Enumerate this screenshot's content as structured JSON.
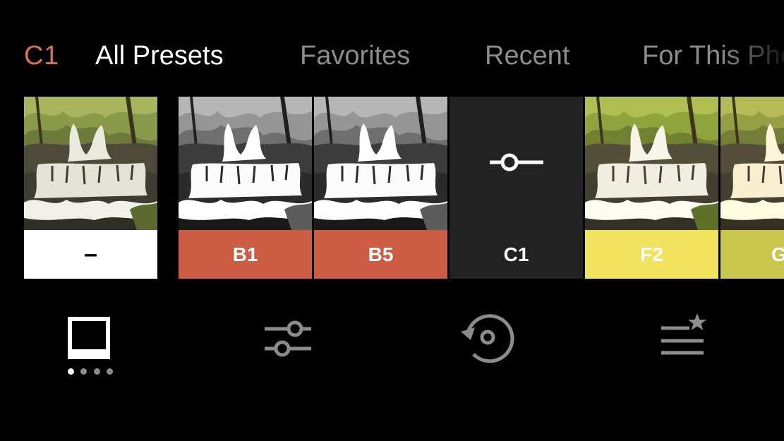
{
  "header": {
    "current_preset": "C1",
    "tabs": [
      {
        "label": "All Presets",
        "active": true
      },
      {
        "label": "Favorites",
        "active": false
      },
      {
        "label": "Recent",
        "active": false
      },
      {
        "label": "For This Photo",
        "active": false
      }
    ]
  },
  "presets": [
    {
      "label": "–",
      "color": "#ffffff",
      "thumb": "original"
    },
    {
      "label": "B1",
      "color": "#cc5c42",
      "thumb": "black-and-white"
    },
    {
      "label": "B5",
      "color": "#cc5c42",
      "thumb": "black-and-white"
    },
    {
      "label": "C1",
      "color": "#232323",
      "thumb": "custom-slider-icon",
      "selected": true
    },
    {
      "label": "F2",
      "color": "#f2e35e",
      "thumb": "color"
    },
    {
      "label": "G",
      "color": "#c9c64e",
      "thumb": "color"
    }
  ],
  "toolbar": {
    "tools": [
      {
        "icon": "presets-frame-icon",
        "active": true
      },
      {
        "icon": "adjust-sliders-icon",
        "active": false
      },
      {
        "icon": "history-icon",
        "active": false
      },
      {
        "icon": "favorites-list-icon",
        "active": false
      }
    ],
    "page_dots": 4,
    "active_page": 0
  },
  "colors": {
    "accent": "#d4744c",
    "tab_inactive": "#8c8c8c",
    "tab_active": "#ffffff",
    "icon_gray": "#8c8c8c",
    "background": "#000000"
  }
}
